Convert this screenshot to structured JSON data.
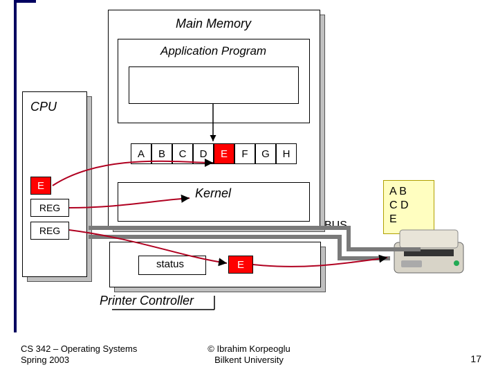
{
  "main_memory": {
    "title": "Main Memory"
  },
  "app_program": {
    "title": "Application Program"
  },
  "cpu": {
    "title": "CPU"
  },
  "cells": {
    "items": [
      {
        "label": "A",
        "red": false
      },
      {
        "label": "B",
        "red": false
      },
      {
        "label": "C",
        "red": false
      },
      {
        "label": "D",
        "red": false
      },
      {
        "label": "E",
        "red": true
      },
      {
        "label": "F",
        "red": false
      },
      {
        "label": "G",
        "red": false
      },
      {
        "label": "H",
        "red": false
      }
    ]
  },
  "regs": {
    "top": {
      "label": "E",
      "red": true
    },
    "middle": {
      "label": "REG"
    },
    "bottom": {
      "label": "REG"
    }
  },
  "kernel": {
    "title": "Kernel"
  },
  "bus": {
    "label": "BUS"
  },
  "status": {
    "label": "status",
    "value": {
      "label": "E",
      "red": true
    }
  },
  "printer_controller": {
    "title": "Printer Controller"
  },
  "paper": {
    "line1": "A  B",
    "line2": "C  D",
    "line3": "E"
  },
  "footer": {
    "left_line1": "CS 342 – Operating Systems",
    "left_line2": "Spring 2003",
    "center_line1": "© Ibrahim Korpeoglu",
    "center_line2": "Bilkent University",
    "slide_number": "17"
  }
}
